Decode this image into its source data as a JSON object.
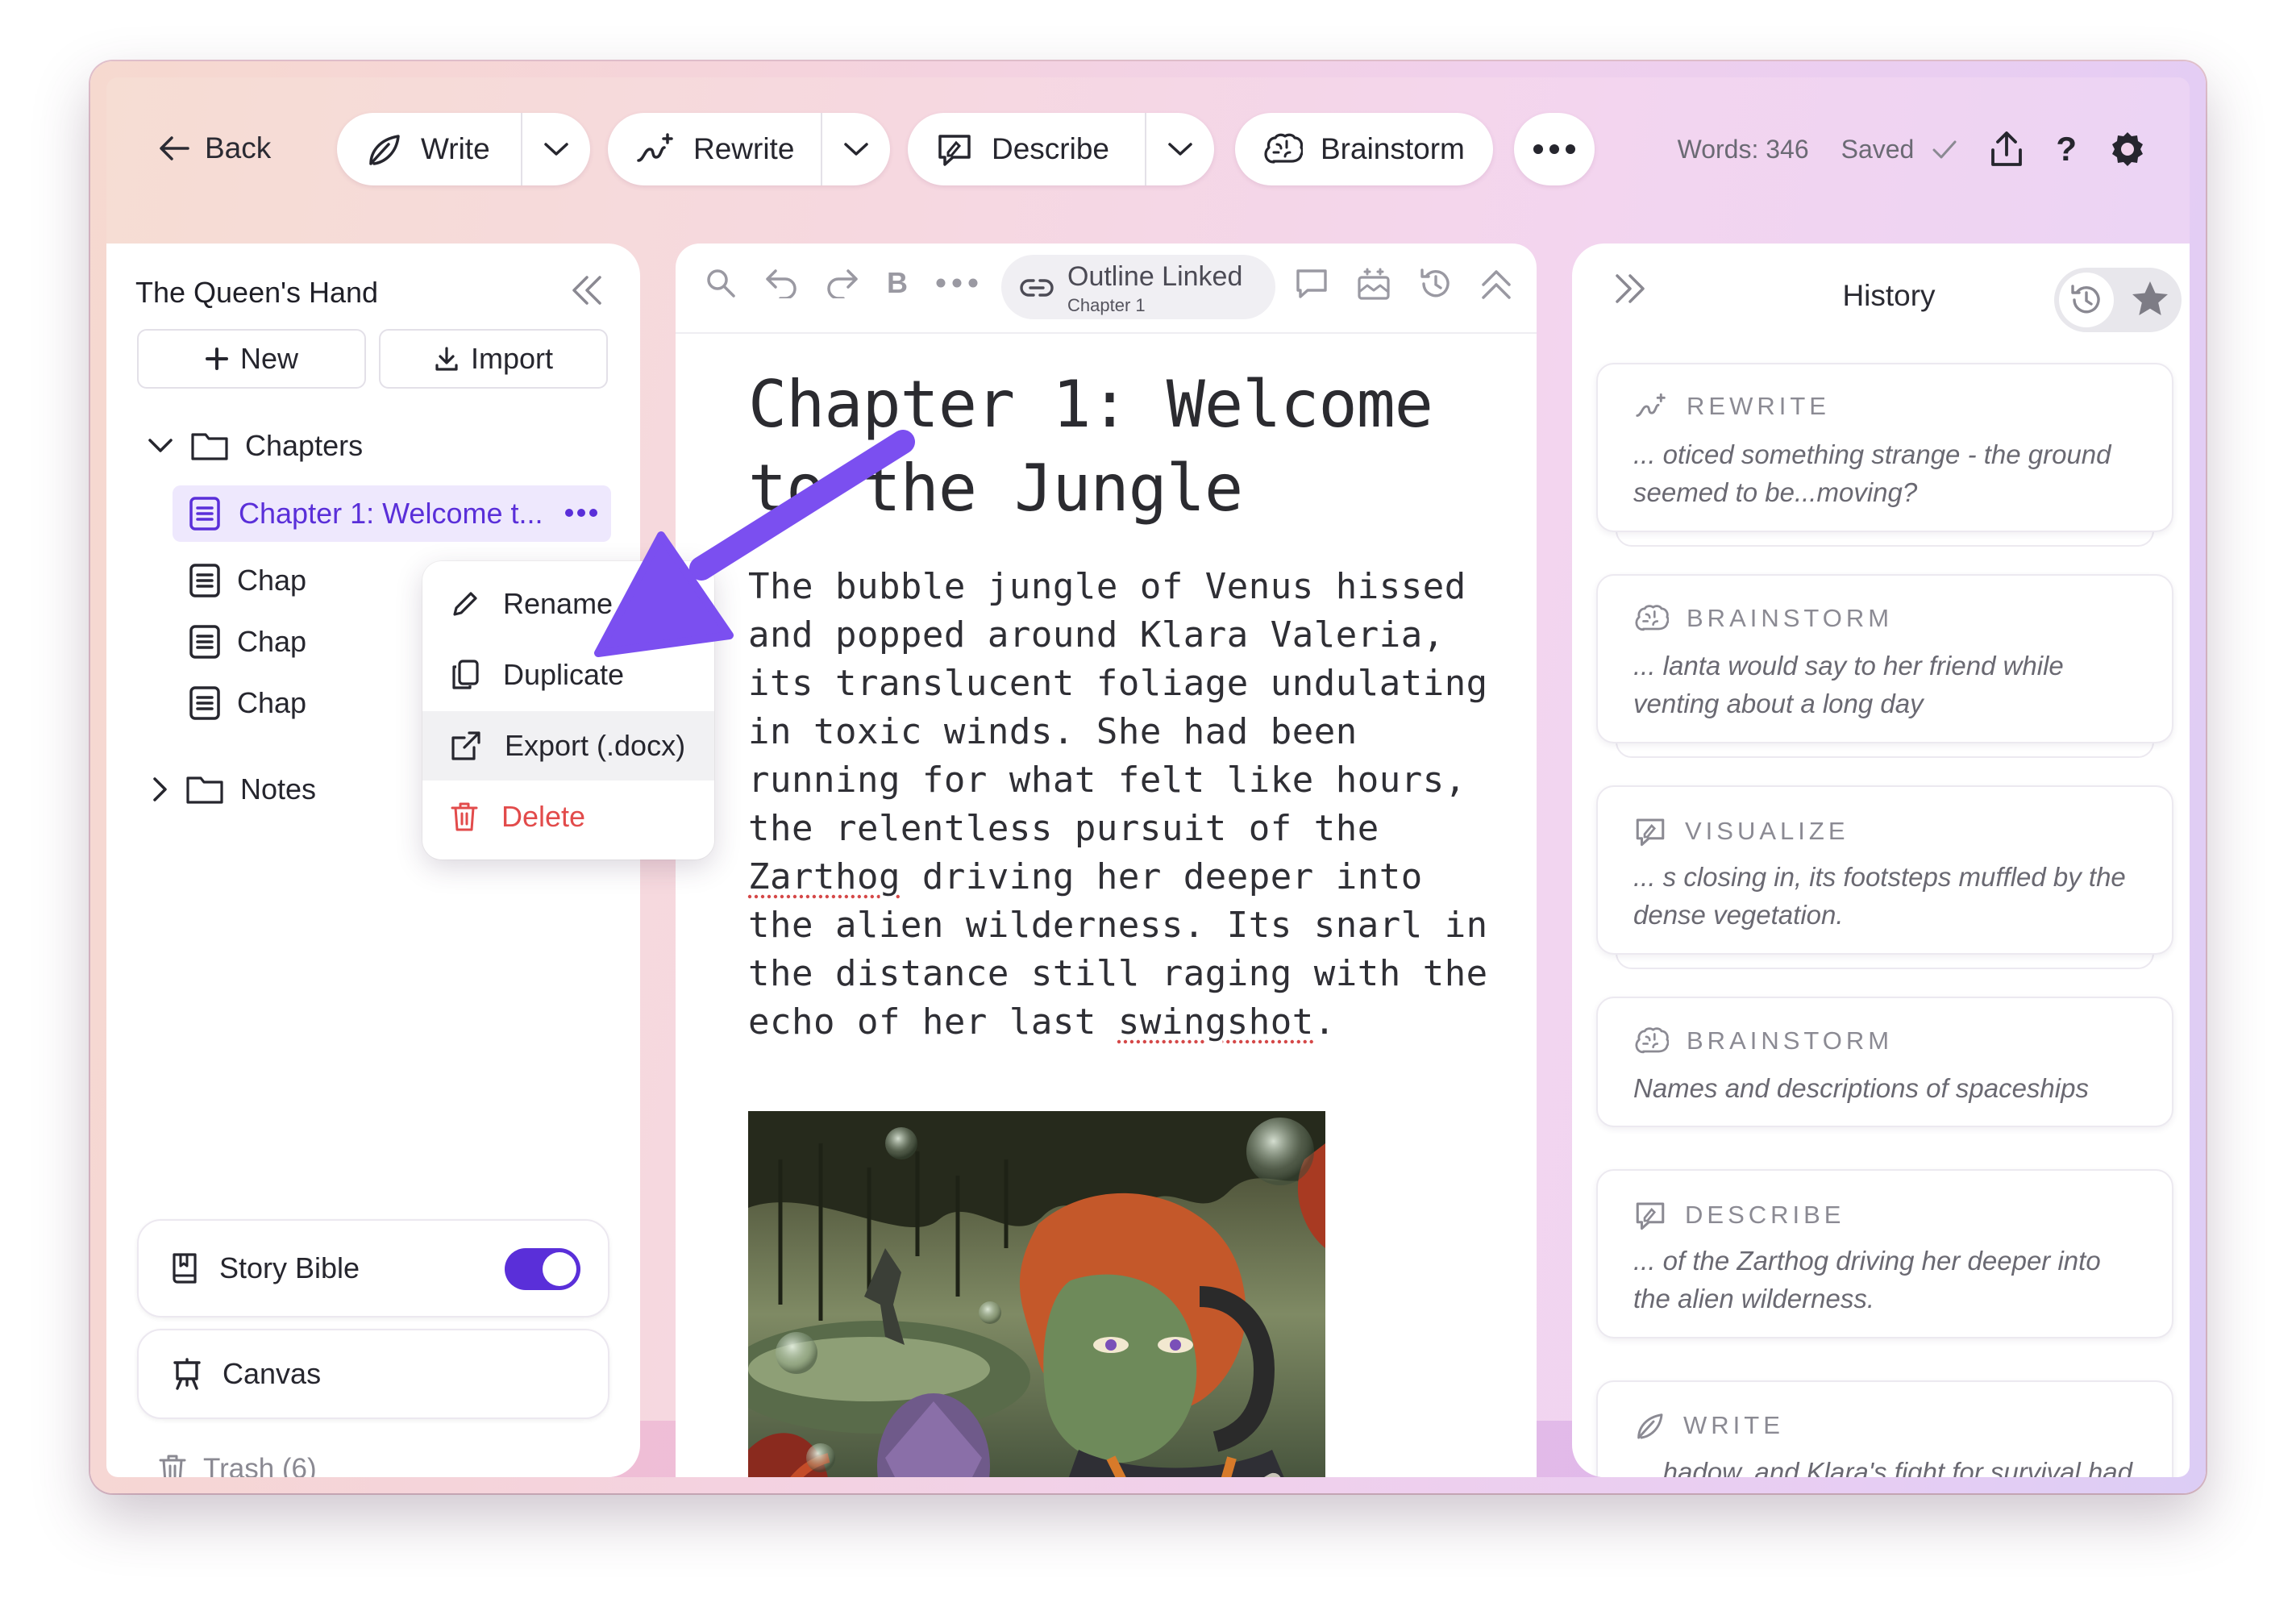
{
  "toolbar": {
    "back_label": "Back",
    "write_label": "Write",
    "rewrite_label": "Rewrite",
    "describe_label": "Describe",
    "brainstorm_label": "Brainstorm",
    "word_count": "Words: 346",
    "saved_label": "Saved",
    "help_label": "?"
  },
  "sidebar": {
    "document_title": "The Queen's Hand",
    "new_label": "New",
    "import_label": "Import",
    "chapters_folder": "Chapters",
    "active_chapter": "Chapter 1: Welcome t...",
    "chapter_items": [
      "Chap",
      "Chap",
      "Chap"
    ],
    "notes_folder": "Notes",
    "story_bible_label": "Story Bible",
    "story_bible_enabled": true,
    "canvas_label": "Canvas",
    "trash_label": "Trash (6)"
  },
  "context_menu": {
    "rename": "Rename",
    "duplicate": "Duplicate",
    "export": "Export (.docx)",
    "delete": "Delete"
  },
  "editor": {
    "outline_linked_label": "Outline Linked",
    "outline_linked_chapter": "Chapter 1",
    "bold_label": "B",
    "chapter_title": "Chapter 1: Welcome to the Jungle",
    "paragraph_before": "The bubble jungle of Venus hissed and popped around Klara Valeria, its translucent foliage undulating in toxic winds. She had been running for what felt like hours, the relentless pursuit of the ",
    "paragraph_word1": "Zarthog",
    "paragraph_middle": " driving her deeper into the alien wilderness. Its snarl in the distance still raging with the echo of her last ",
    "paragraph_word2": "swingshot",
    "paragraph_after": "."
  },
  "history": {
    "title": "History",
    "entries": [
      {
        "type": "REWRITE",
        "icon": "rewrite-icon",
        "text": "... oticed something strange - the ground seemed to be...moving?"
      },
      {
        "type": "BRAINSTORM",
        "icon": "brain-icon",
        "text": "... lanta would say to her friend while venting about a long day"
      },
      {
        "type": "VISUALIZE",
        "icon": "visualize-icon",
        "text": "... s closing in, its footsteps muffled by the dense vegetation."
      },
      {
        "type": "BRAINSTORM",
        "icon": "brain-icon",
        "text": "Names and descriptions of spaceships"
      },
      {
        "type": "DESCRIBE",
        "icon": "describe-icon",
        "text": "... of the Zarthog driving her deeper into the alien wilderness."
      },
      {
        "type": "WRITE",
        "icon": "feather-icon",
        "text": "... hadow, and Klara's fight for survival had only just begun"
      }
    ]
  },
  "colors": {
    "accent": "#5a2fd9",
    "annotation_arrow": "#7b4ff0",
    "delete": "#e24b4b"
  }
}
